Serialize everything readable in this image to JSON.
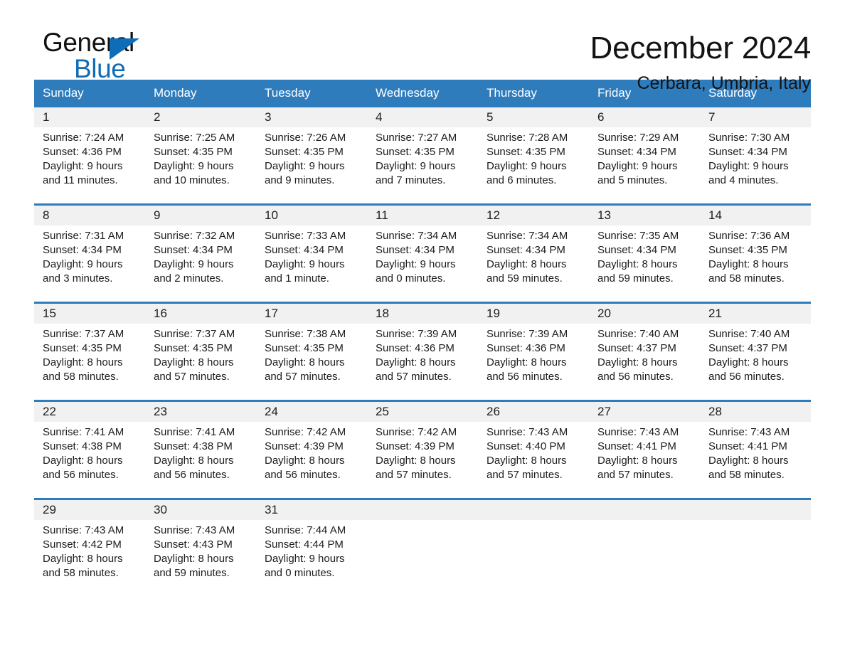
{
  "brand": {
    "name_part1": "General",
    "name_part2": "Blue",
    "accent_color": "#0f6cb6"
  },
  "header": {
    "month_title": "December 2024",
    "location": "Cerbara, Umbria, Italy",
    "header_bg_color": "#2f7cbd",
    "daynum_bg_color": "#f1f1f1"
  },
  "weekdays": [
    "Sunday",
    "Monday",
    "Tuesday",
    "Wednesday",
    "Thursday",
    "Friday",
    "Saturday"
  ],
  "weeks": [
    [
      {
        "day": "1",
        "sunrise": "Sunrise: 7:24 AM",
        "sunset": "Sunset: 4:36 PM",
        "daylight1": "Daylight: 9 hours",
        "daylight2": "and 11 minutes."
      },
      {
        "day": "2",
        "sunrise": "Sunrise: 7:25 AM",
        "sunset": "Sunset: 4:35 PM",
        "daylight1": "Daylight: 9 hours",
        "daylight2": "and 10 minutes."
      },
      {
        "day": "3",
        "sunrise": "Sunrise: 7:26 AM",
        "sunset": "Sunset: 4:35 PM",
        "daylight1": "Daylight: 9 hours",
        "daylight2": "and 9 minutes."
      },
      {
        "day": "4",
        "sunrise": "Sunrise: 7:27 AM",
        "sunset": "Sunset: 4:35 PM",
        "daylight1": "Daylight: 9 hours",
        "daylight2": "and 7 minutes."
      },
      {
        "day": "5",
        "sunrise": "Sunrise: 7:28 AM",
        "sunset": "Sunset: 4:35 PM",
        "daylight1": "Daylight: 9 hours",
        "daylight2": "and 6 minutes."
      },
      {
        "day": "6",
        "sunrise": "Sunrise: 7:29 AM",
        "sunset": "Sunset: 4:34 PM",
        "daylight1": "Daylight: 9 hours",
        "daylight2": "and 5 minutes."
      },
      {
        "day": "7",
        "sunrise": "Sunrise: 7:30 AM",
        "sunset": "Sunset: 4:34 PM",
        "daylight1": "Daylight: 9 hours",
        "daylight2": "and 4 minutes."
      }
    ],
    [
      {
        "day": "8",
        "sunrise": "Sunrise: 7:31 AM",
        "sunset": "Sunset: 4:34 PM",
        "daylight1": "Daylight: 9 hours",
        "daylight2": "and 3 minutes."
      },
      {
        "day": "9",
        "sunrise": "Sunrise: 7:32 AM",
        "sunset": "Sunset: 4:34 PM",
        "daylight1": "Daylight: 9 hours",
        "daylight2": "and 2 minutes."
      },
      {
        "day": "10",
        "sunrise": "Sunrise: 7:33 AM",
        "sunset": "Sunset: 4:34 PM",
        "daylight1": "Daylight: 9 hours",
        "daylight2": "and 1 minute."
      },
      {
        "day": "11",
        "sunrise": "Sunrise: 7:34 AM",
        "sunset": "Sunset: 4:34 PM",
        "daylight1": "Daylight: 9 hours",
        "daylight2": "and 0 minutes."
      },
      {
        "day": "12",
        "sunrise": "Sunrise: 7:34 AM",
        "sunset": "Sunset: 4:34 PM",
        "daylight1": "Daylight: 8 hours",
        "daylight2": "and 59 minutes."
      },
      {
        "day": "13",
        "sunrise": "Sunrise: 7:35 AM",
        "sunset": "Sunset: 4:34 PM",
        "daylight1": "Daylight: 8 hours",
        "daylight2": "and 59 minutes."
      },
      {
        "day": "14",
        "sunrise": "Sunrise: 7:36 AM",
        "sunset": "Sunset: 4:35 PM",
        "daylight1": "Daylight: 8 hours",
        "daylight2": "and 58 minutes."
      }
    ],
    [
      {
        "day": "15",
        "sunrise": "Sunrise: 7:37 AM",
        "sunset": "Sunset: 4:35 PM",
        "daylight1": "Daylight: 8 hours",
        "daylight2": "and 58 minutes."
      },
      {
        "day": "16",
        "sunrise": "Sunrise: 7:37 AM",
        "sunset": "Sunset: 4:35 PM",
        "daylight1": "Daylight: 8 hours",
        "daylight2": "and 57 minutes."
      },
      {
        "day": "17",
        "sunrise": "Sunrise: 7:38 AM",
        "sunset": "Sunset: 4:35 PM",
        "daylight1": "Daylight: 8 hours",
        "daylight2": "and 57 minutes."
      },
      {
        "day": "18",
        "sunrise": "Sunrise: 7:39 AM",
        "sunset": "Sunset: 4:36 PM",
        "daylight1": "Daylight: 8 hours",
        "daylight2": "and 57 minutes."
      },
      {
        "day": "19",
        "sunrise": "Sunrise: 7:39 AM",
        "sunset": "Sunset: 4:36 PM",
        "daylight1": "Daylight: 8 hours",
        "daylight2": "and 56 minutes."
      },
      {
        "day": "20",
        "sunrise": "Sunrise: 7:40 AM",
        "sunset": "Sunset: 4:37 PM",
        "daylight1": "Daylight: 8 hours",
        "daylight2": "and 56 minutes."
      },
      {
        "day": "21",
        "sunrise": "Sunrise: 7:40 AM",
        "sunset": "Sunset: 4:37 PM",
        "daylight1": "Daylight: 8 hours",
        "daylight2": "and 56 minutes."
      }
    ],
    [
      {
        "day": "22",
        "sunrise": "Sunrise: 7:41 AM",
        "sunset": "Sunset: 4:38 PM",
        "daylight1": "Daylight: 8 hours",
        "daylight2": "and 56 minutes."
      },
      {
        "day": "23",
        "sunrise": "Sunrise: 7:41 AM",
        "sunset": "Sunset: 4:38 PM",
        "daylight1": "Daylight: 8 hours",
        "daylight2": "and 56 minutes."
      },
      {
        "day": "24",
        "sunrise": "Sunrise: 7:42 AM",
        "sunset": "Sunset: 4:39 PM",
        "daylight1": "Daylight: 8 hours",
        "daylight2": "and 56 minutes."
      },
      {
        "day": "25",
        "sunrise": "Sunrise: 7:42 AM",
        "sunset": "Sunset: 4:39 PM",
        "daylight1": "Daylight: 8 hours",
        "daylight2": "and 57 minutes."
      },
      {
        "day": "26",
        "sunrise": "Sunrise: 7:43 AM",
        "sunset": "Sunset: 4:40 PM",
        "daylight1": "Daylight: 8 hours",
        "daylight2": "and 57 minutes."
      },
      {
        "day": "27",
        "sunrise": "Sunrise: 7:43 AM",
        "sunset": "Sunset: 4:41 PM",
        "daylight1": "Daylight: 8 hours",
        "daylight2": "and 57 minutes."
      },
      {
        "day": "28",
        "sunrise": "Sunrise: 7:43 AM",
        "sunset": "Sunset: 4:41 PM",
        "daylight1": "Daylight: 8 hours",
        "daylight2": "and 58 minutes."
      }
    ],
    [
      {
        "day": "29",
        "sunrise": "Sunrise: 7:43 AM",
        "sunset": "Sunset: 4:42 PM",
        "daylight1": "Daylight: 8 hours",
        "daylight2": "and 58 minutes."
      },
      {
        "day": "30",
        "sunrise": "Sunrise: 7:43 AM",
        "sunset": "Sunset: 4:43 PM",
        "daylight1": "Daylight: 8 hours",
        "daylight2": "and 59 minutes."
      },
      {
        "day": "31",
        "sunrise": "Sunrise: 7:44 AM",
        "sunset": "Sunset: 4:44 PM",
        "daylight1": "Daylight: 9 hours",
        "daylight2": "and 0 minutes."
      },
      {
        "day": "",
        "sunrise": "",
        "sunset": "",
        "daylight1": "",
        "daylight2": ""
      },
      {
        "day": "",
        "sunrise": "",
        "sunset": "",
        "daylight1": "",
        "daylight2": ""
      },
      {
        "day": "",
        "sunrise": "",
        "sunset": "",
        "daylight1": "",
        "daylight2": ""
      },
      {
        "day": "",
        "sunrise": "",
        "sunset": "",
        "daylight1": "",
        "daylight2": ""
      }
    ]
  ]
}
